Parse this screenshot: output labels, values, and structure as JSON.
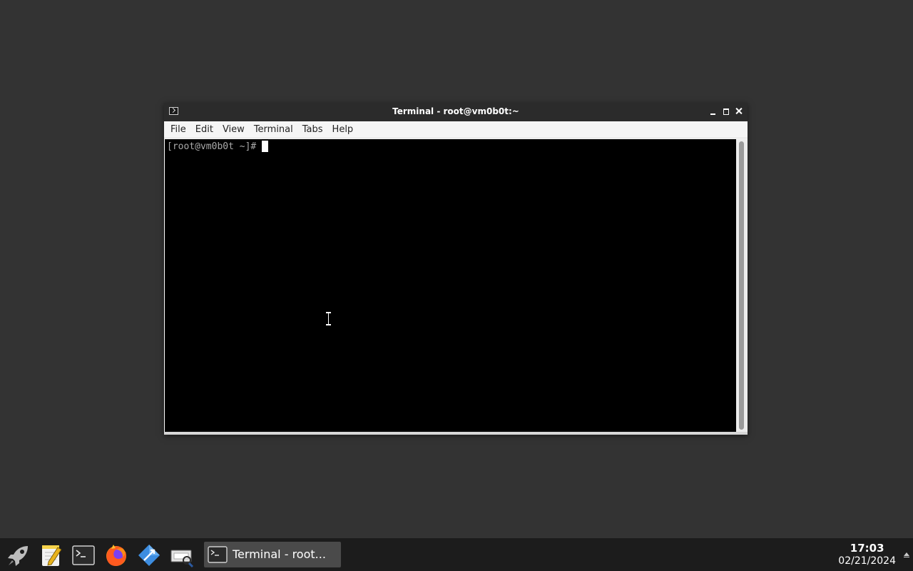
{
  "window": {
    "title": "Terminal - root@vm0b0t:~",
    "icon": "terminal-icon"
  },
  "menubar": {
    "items": [
      "File",
      "Edit",
      "View",
      "Terminal",
      "Tabs",
      "Help"
    ]
  },
  "terminal": {
    "prompt": "[root@vm0b0t ~]# "
  },
  "taskbar": {
    "launchers": [
      {
        "name": "rocket-icon",
        "label": "Application launcher"
      },
      {
        "name": "text-editor-icon",
        "label": "Text editor"
      },
      {
        "name": "terminal-icon",
        "label": "Terminal"
      },
      {
        "name": "firefox-icon",
        "label": "Firefox"
      },
      {
        "name": "files-icon",
        "label": "Files"
      },
      {
        "name": "screenshot-icon",
        "label": "Screenshot"
      }
    ],
    "task": {
      "label": "Terminal - root..."
    },
    "clock": {
      "time": "17:03",
      "date": "02/21/2024"
    }
  },
  "colors": {
    "desktop": "#333333",
    "titlebar": "#2b2b2b",
    "terminal_bg": "#000000",
    "prompt_text": "#aaaaaa",
    "taskbar": "#1c1c1c"
  }
}
